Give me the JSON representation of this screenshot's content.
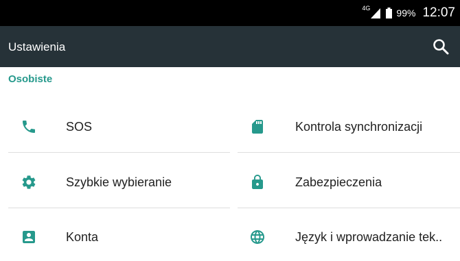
{
  "status_bar": {
    "network": "4G",
    "battery": "99%",
    "time": "12:07"
  },
  "app_bar": {
    "title": "Ustawienia"
  },
  "section": {
    "title": "Osobiste"
  },
  "left_column": [
    {
      "label": "SOS",
      "icon": "phone-icon"
    },
    {
      "label": "Szybkie wybieranie",
      "icon": "gear-icon"
    },
    {
      "label": "Konta",
      "icon": "account-box-icon"
    }
  ],
  "right_column": [
    {
      "label": "Kontrola synchronizacji",
      "icon": "sd-card-icon"
    },
    {
      "label": "Zabezpieczenia",
      "icon": "lock-icon"
    },
    {
      "label": "Język i wprowadzanie tek..",
      "icon": "globe-icon"
    }
  ],
  "colors": {
    "accent": "#26998c",
    "app_bar": "#263238",
    "status_bar": "#000000"
  }
}
